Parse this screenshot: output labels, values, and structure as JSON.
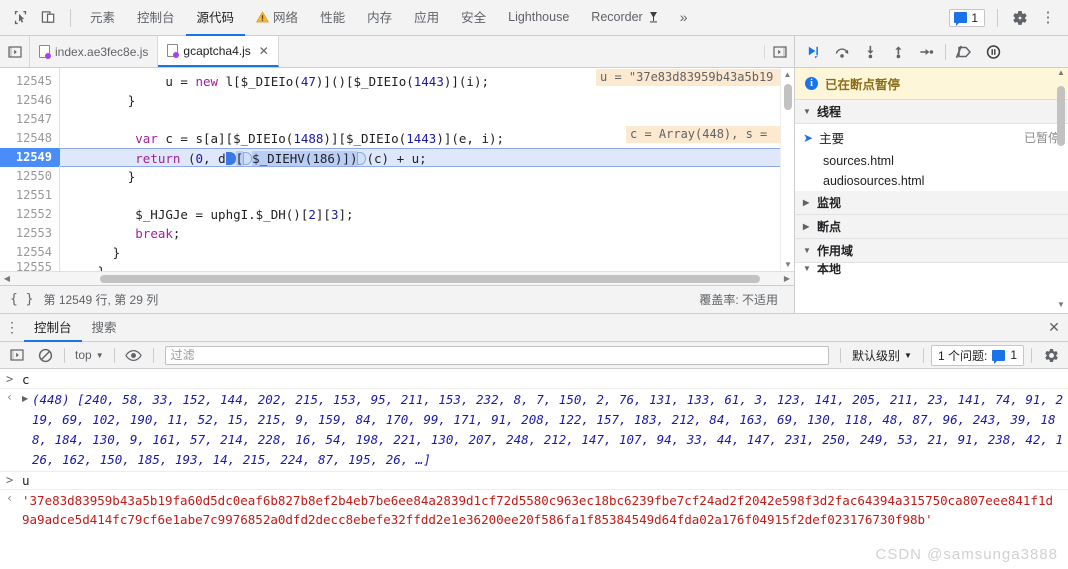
{
  "topbar": {
    "inspect_icon": "inspect-cursor-icon",
    "device_icon": "device-toolbar-icon",
    "tabs": [
      {
        "label": "元素",
        "active": false,
        "warn": false
      },
      {
        "label": "控制台",
        "active": false,
        "warn": false
      },
      {
        "label": "源代码",
        "active": true,
        "warn": false
      },
      {
        "label": "网络",
        "active": false,
        "warn": true
      },
      {
        "label": "性能",
        "active": false,
        "warn": false
      },
      {
        "label": "内存",
        "active": false,
        "warn": false
      },
      {
        "label": "应用",
        "active": false,
        "warn": false
      },
      {
        "label": "安全",
        "active": false,
        "warn": false
      },
      {
        "label": "Lighthouse",
        "active": false,
        "warn": false
      },
      {
        "label": "Recorder",
        "active": false,
        "warn": false,
        "suffix_icon": "recorder-icon"
      }
    ],
    "overflow_label": "»",
    "issues_count": "1",
    "settings_icon": "gear-icon",
    "more_icon": "kebab-menu-icon"
  },
  "filetabs": {
    "nav_icon": "show-navigator-icon",
    "tabs": [
      {
        "label": "index.ae3fec8e.js",
        "active": false,
        "closable": false
      },
      {
        "label": "gcaptcha4.js",
        "active": true,
        "closable": true,
        "close_label": "✕"
      }
    ],
    "right_nav_icon": "show-debugger-icon"
  },
  "editor": {
    "first_line": 12545,
    "lines": [
      {
        "n": "12545",
        "indent": 14,
        "tokens": [
          {
            "t": "u = ",
            "c": "plain"
          },
          {
            "t": "new",
            "c": "kw"
          },
          {
            "t": " l[$_DIEIo(",
            "c": "plain"
          },
          {
            "t": "47",
            "c": "num"
          },
          {
            "t": ")]()[$_DIEIo(",
            "c": "plain"
          },
          {
            "t": "1443",
            "c": "num"
          },
          {
            "t": ")](i);",
            "c": "plain"
          }
        ]
      },
      {
        "n": "12546",
        "indent": 9,
        "tokens": [
          {
            "t": "}",
            "c": "plain"
          }
        ]
      },
      {
        "n": "12547",
        "indent": 0,
        "tokens": []
      },
      {
        "n": "12548",
        "indent": 10,
        "tokens": [
          {
            "t": "var",
            "c": "kw"
          },
          {
            "t": " c = s[a][$_DIEIo(",
            "c": "plain"
          },
          {
            "t": "1488",
            "c": "num"
          },
          {
            "t": ")][$_DIEIo(",
            "c": "plain"
          },
          {
            "t": "1443",
            "c": "num"
          },
          {
            "t": ")](e, i);",
            "c": "plain"
          }
        ]
      },
      {
        "n": "12549",
        "current": true,
        "indent": 10,
        "tokens": [
          {
            "t": "return",
            "c": "kw"
          },
          {
            "t": " (",
            "c": "plain"
          },
          {
            "t": "0",
            "c": "num"
          },
          {
            "t": ", d",
            "c": "plain"
          }
        ]
      },
      {
        "n": "12550",
        "indent": 9,
        "tokens": [
          {
            "t": "}",
            "c": "plain"
          }
        ]
      },
      {
        "n": "12551",
        "indent": 0,
        "tokens": []
      },
      {
        "n": "12552",
        "indent": 10,
        "tokens": [
          {
            "t": "$_HJGJe = uphgI.$_DH()[",
            "c": "plain"
          },
          {
            "t": "2",
            "c": "num"
          },
          {
            "t": "][",
            "c": "plain"
          },
          {
            "t": "3",
            "c": "num"
          },
          {
            "t": "];",
            "c": "plain"
          }
        ]
      },
      {
        "n": "12553",
        "indent": 10,
        "tokens": [
          {
            "t": "break",
            "c": "kw"
          },
          {
            "t": ";",
            "c": "plain"
          }
        ]
      },
      {
        "n": "12554",
        "indent": 7,
        "tokens": [
          {
            "t": "}",
            "c": "plain"
          }
        ]
      },
      {
        "n": "12555",
        "clipped": true,
        "indent": 5,
        "tokens": [
          {
            "t": "}",
            "c": "plain"
          }
        ]
      }
    ],
    "current_line_tail": "$_DIEHV(186)])",
    "current_line_end": "(c) + u;",
    "inline_values": [
      {
        "line": 0,
        "text": "u = \"37e83d83959b43a5b19"
      },
      {
        "line": 3,
        "text": "c = Array(448), s = "
      }
    ]
  },
  "statusbar": {
    "format_icon": "pretty-print-icon",
    "position": "第 12549 行, 第 29 列",
    "coverage": "覆盖率: 不适用"
  },
  "debugger": {
    "toolbar": [
      {
        "name": "resume-button",
        "icon": "resume-icon"
      },
      {
        "name": "step-over-button",
        "icon": "step-over-icon"
      },
      {
        "name": "step-into-button",
        "icon": "step-into-icon"
      },
      {
        "name": "step-out-button",
        "icon": "step-out-icon"
      },
      {
        "name": "step-button",
        "icon": "step-icon"
      },
      {
        "name": "deactivate-breakpoints-button",
        "icon": "deactivate-breakpoints-icon"
      },
      {
        "name": "pause-on-exceptions-button",
        "icon": "pause-on-exceptions-icon"
      }
    ],
    "paused_message": "已在断点暂停",
    "sections": [
      {
        "label": "线程",
        "expanded": true
      },
      {
        "label": "监视",
        "expanded": false
      },
      {
        "label": "断点",
        "expanded": false
      },
      {
        "label": "作用域",
        "expanded": true
      },
      {
        "label": "本地",
        "expanded": true
      }
    ],
    "thread": {
      "label": "主要",
      "status": "已暂停"
    },
    "frames": [
      "sources.html",
      "audiosources.html"
    ]
  },
  "drawer": {
    "menu_icon": "kebab-menu-icon",
    "tabs": [
      {
        "label": "控制台",
        "active": true
      },
      {
        "label": "搜索",
        "active": false
      }
    ],
    "close_label": "✕"
  },
  "console_toolbar": {
    "sidebar_icon": "console-sidebar-icon",
    "clear_icon": "clear-console-icon",
    "context": "top",
    "eye_icon": "live-expression-icon",
    "filter_placeholder": "过滤",
    "filter_value": "",
    "level": "默认级别",
    "issues_text": "1 个问题:",
    "issues_count": "1",
    "settings_icon": "gear-icon"
  },
  "console": {
    "entries": [
      {
        "type": "input",
        "marker": ">",
        "text": "c"
      },
      {
        "type": "output",
        "marker": "‹",
        "value": "(448) [240, 58, 33, 152, 144, 202, 215, 153, 95, 211, 153, 232, 8, 7, 150, 2, 76, 131, 133, 61, 3, 123, 141, 205, 211, 23, 141, 74, 91, 219, 69, 102, 190, 11, 52, 15, 215, 9, 159, 84, 170, 99, 171, 91, 208, 122, 157, 183, 212, 84, 163, 69, 130, 118, 48, 87, 96, 243, 39, 188, 184, 130, 9, 161, 57, 214, 228, 16, 54, 198, 221, 130, 207, 248, 212, 147, 107, 94, 33, 44, 147, 231, 250, 249, 53, 21, 91, 238, 42, 126, 162, 150, 185, 193, 14, 215, 224, 87, 195, 26, …]",
        "expandable": true
      },
      {
        "type": "input",
        "marker": ">",
        "text": "u"
      },
      {
        "type": "output",
        "marker": "‹",
        "value": "'37e83d83959b43a5b19fa60d5dc0eaf6b827b8ef2b4eb7be6ee84a2839d1cf72d5580c963ec18bc6239fbe7cf24ad2f2042e598f3d2fac64394a315750ca807eee841f1d9a9adce5d414fc79cf6e1abe7c9976852a0dfd2decc8ebefe32ffdd2e1e36200ee20f586fa1f85384549d64fda02a176f04915f2def023176730f98b'",
        "is_string": true
      }
    ],
    "array_length": "448",
    "watermark": "CSDN @samsunga3888"
  }
}
